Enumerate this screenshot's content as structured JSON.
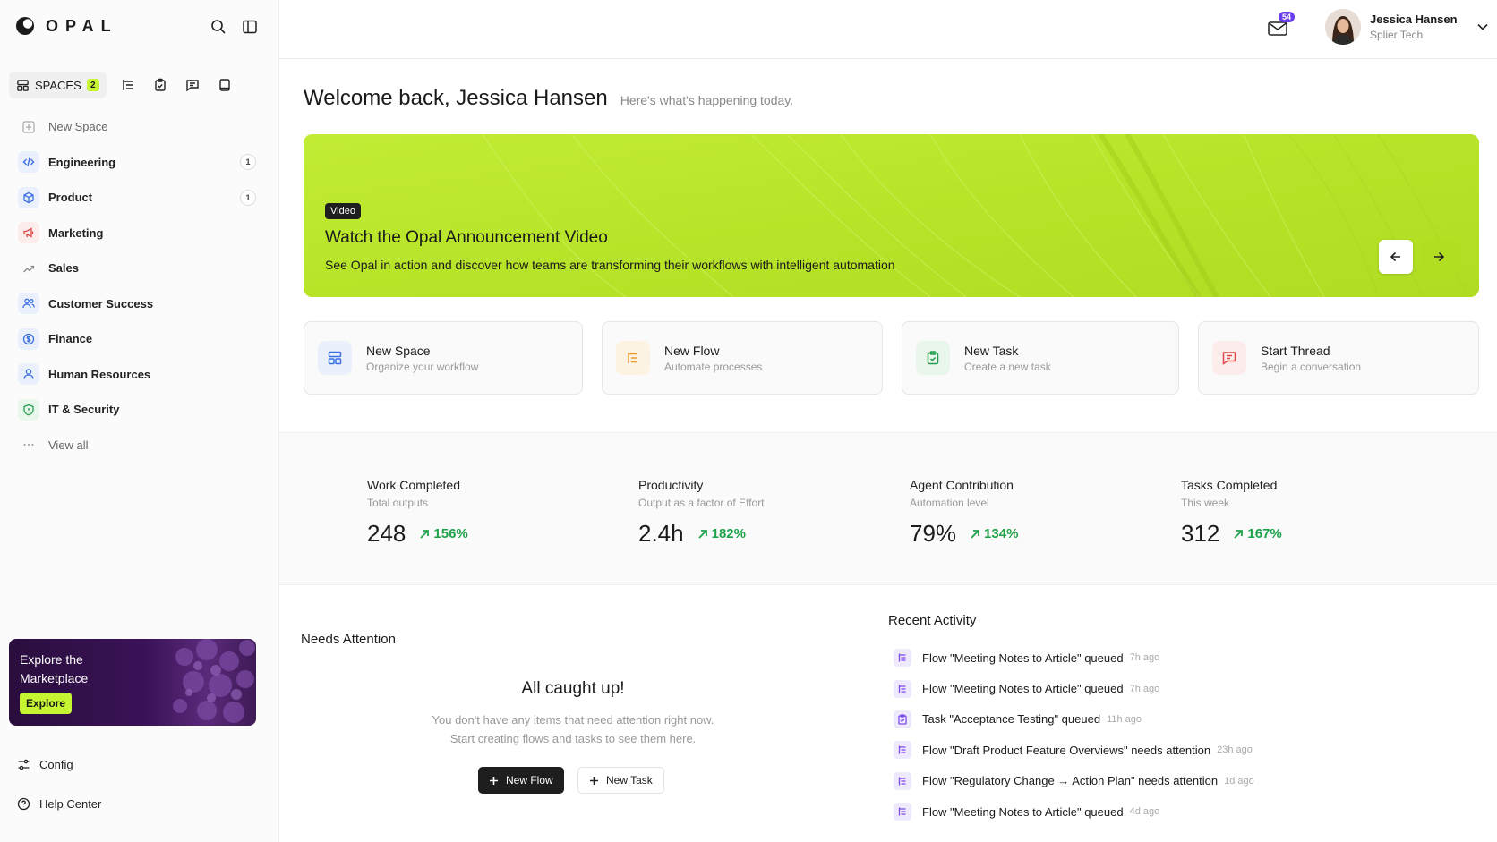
{
  "app": {
    "brand": "OPAL",
    "accent": "#c6f532"
  },
  "sidebar": {
    "spaces_tab": {
      "label": "SPACES",
      "count": "2"
    },
    "new_space": "New Space",
    "items": [
      {
        "label": "Engineering",
        "icon": "code-icon",
        "badge": "1"
      },
      {
        "label": "Product",
        "icon": "cube-icon",
        "badge": "1"
      },
      {
        "label": "Marketing",
        "icon": "megaphone-icon",
        "badge": ""
      },
      {
        "label": "Sales",
        "icon": "trending-up-icon",
        "badge": ""
      },
      {
        "label": "Customer Success",
        "icon": "users-icon",
        "badge": ""
      },
      {
        "label": "Finance",
        "icon": "dollar-icon",
        "badge": ""
      },
      {
        "label": "Human Resources",
        "icon": "user-icon",
        "badge": ""
      },
      {
        "label": "IT & Security",
        "icon": "shield-icon",
        "badge": ""
      }
    ],
    "view_all": "View all",
    "promo": {
      "title": "Explore the Marketplace",
      "button": "Explore"
    },
    "config": "Config",
    "help": "Help Center"
  },
  "topbar": {
    "mail_count": "54",
    "user": {
      "name": "Jessica Hansen",
      "org": "Splier Tech"
    }
  },
  "welcome": {
    "title": "Welcome back, Jessica Hansen",
    "subtitle": "Here's what's happening today."
  },
  "hero": {
    "tag": "Video",
    "title": "Watch the Opal Announcement Video",
    "description": "See Opal in action and discover how teams are transforming their workflows with intelligent automation"
  },
  "actions": [
    {
      "title": "New Space",
      "subtitle": "Organize your workflow",
      "icon": "layout-icon",
      "color": "#3b6fe0"
    },
    {
      "title": "New Flow",
      "subtitle": "Automate processes",
      "icon": "flow-icon",
      "color": "#e89a2a"
    },
    {
      "title": "New Task",
      "subtitle": "Create a new task",
      "icon": "clipboard-icon",
      "color": "#22a050"
    },
    {
      "title": "Start Thread",
      "subtitle": "Begin a conversation",
      "icon": "message-icon",
      "color": "#e04848"
    }
  ],
  "stats": [
    {
      "title": "Work Completed",
      "subtitle": "Total outputs",
      "value": "248",
      "delta": "156%"
    },
    {
      "title": "Productivity",
      "subtitle": "Output as a factor of Effort",
      "value": "2.4h",
      "delta": "182%"
    },
    {
      "title": "Agent Contribution",
      "subtitle": "Automation level",
      "value": "79%",
      "delta": "134%"
    },
    {
      "title": "Tasks Completed",
      "subtitle": "This week",
      "value": "312",
      "delta": "167%"
    }
  ],
  "needs_attention": {
    "title": "Needs Attention",
    "heading": "All caught up!",
    "description": "You don't have any items that need attention right now. Start creating flows and tasks to see them here.",
    "primary_button": "New Flow",
    "secondary_button": "New Task"
  },
  "recent_activity": {
    "title": "Recent Activity",
    "items": [
      {
        "text": "Flow \"Meeting Notes to Article\" queued",
        "ago": "7h ago",
        "icon": "flow-icon"
      },
      {
        "text": "Flow \"Meeting Notes to Article\" queued",
        "ago": "7h ago",
        "icon": "flow-icon"
      },
      {
        "text": "Task \"Acceptance Testing\" queued",
        "ago": "11h ago",
        "icon": "clipboard-icon"
      },
      {
        "text": "Flow \"Draft Product Feature Overviews\" needs attention",
        "ago": "23h ago",
        "icon": "flow-icon"
      },
      {
        "text": "Flow \"Regulatory Change → Action Plan\" needs attention",
        "ago": "1d ago",
        "icon": "flow-icon"
      },
      {
        "text": "Flow \"Meeting Notes to Article\" queued",
        "ago": "4d ago",
        "icon": "flow-icon"
      }
    ]
  }
}
